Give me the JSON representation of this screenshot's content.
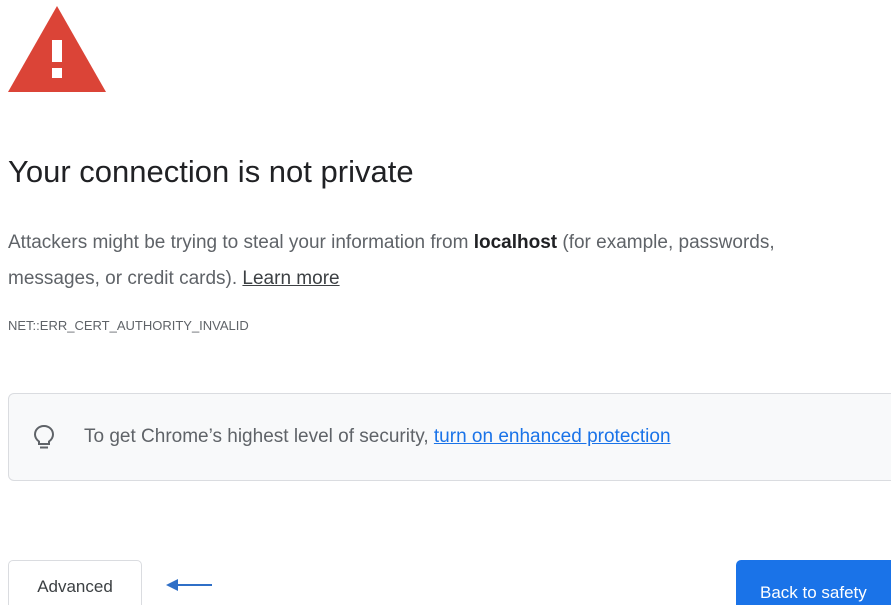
{
  "interstitial": {
    "heading": "Your connection is not private",
    "description_before": "Attackers might be trying to steal your information from ",
    "host": "localhost",
    "description_after": " (for example, passwords, messages, or credit cards). ",
    "learn_more": "Learn more",
    "error_code": "NET::ERR_CERT_AUTHORITY_INVALID"
  },
  "enhanced_protection": {
    "text": "To get Chrome’s highest level of security, ",
    "link": "turn on enhanced protection"
  },
  "buttons": {
    "advanced": "Advanced",
    "back_to_safety": "Back to safety"
  },
  "icons": {
    "warning": "warning-triangle-icon",
    "bulb": "lightbulb-icon",
    "arrow": "left-arrow-icon"
  },
  "colors": {
    "warning_red": "#db4437",
    "link_blue": "#1a73e8",
    "primary_button": "#1a73e8"
  }
}
